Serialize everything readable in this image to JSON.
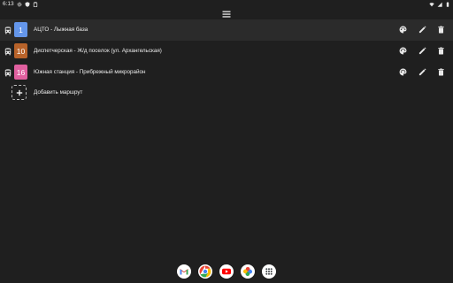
{
  "status": {
    "time": "6:13"
  },
  "routes": [
    {
      "number": "1",
      "name": "АЦТО - Лыжная база",
      "color": "#6496ea",
      "selected": true
    },
    {
      "number": "10",
      "name": "Диспетчерская - Ж/д поселок (ул. Архангельская)",
      "color": "#b8632a",
      "selected": false
    },
    {
      "number": "16",
      "name": "Южная станция - Прибрежный микрорайон",
      "color": "#e0609f",
      "selected": false
    }
  ],
  "add_route": {
    "label": "Добавить маршрут"
  },
  "colors": {
    "background": "#1f1f1f",
    "selected_row": "#2b2b2b",
    "text": "#e8e8e8"
  },
  "icons": {
    "toolbar": "menu-icon",
    "row": [
      "bus-icon",
      "palette-icon",
      "edit-icon",
      "delete-icon"
    ],
    "dock": [
      "gmail-icon",
      "chrome-icon",
      "youtube-icon",
      "photos-icon",
      "app-drawer-icon"
    ]
  }
}
